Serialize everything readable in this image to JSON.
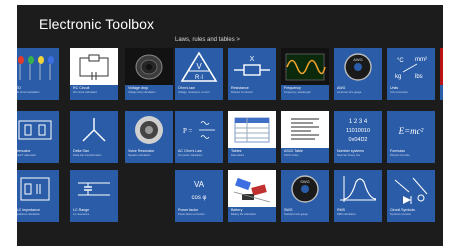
{
  "app": {
    "title": "Electronic Toolbox"
  },
  "section": {
    "heading": "Laws, rules and tables >"
  },
  "art_text": {
    "ohms_law": "V\nR·I",
    "power": "VA\ncos φ",
    "binary": "1 2 3 4\n11010010\n0x04D2",
    "emc2": "E=mc²",
    "formula": "P = ",
    "units_top": "mm²",
    "units_bottom": "lbs"
  },
  "tiles": [
    {
      "id": "led",
      "label": "LED",
      "sub": "LED circuit calculation",
      "icon": "leds-icon"
    },
    {
      "id": "rc-circuit",
      "label": "RC Circuit",
      "sub": "RC circuit calculation",
      "icon": "rc-circuit-icon"
    },
    {
      "id": "voltage-drop",
      "label": "Voltage drop",
      "sub": "Voltage drop calculation",
      "icon": "cable-spool-icon"
    },
    {
      "id": "ohms-law",
      "label": "Ohm's law",
      "sub": "Voltage, resistance, current",
      "icon": "ohms-law-icon"
    },
    {
      "id": "resistance",
      "label": "Resistance",
      "sub": "Resistor & inductor",
      "icon": "resistor-icon"
    },
    {
      "id": "frequency",
      "label": "Frequency",
      "sub": "Frequency, wavelength",
      "icon": "sine-wave-icon"
    },
    {
      "id": "awg",
      "label": "AWG",
      "sub": "American wire gauge",
      "icon": "awg-gauge-icon"
    },
    {
      "id": "units",
      "label": "Units",
      "sub": "Unit conversion",
      "icon": "units-icon"
    },
    {
      "id": "glossary",
      "label": "Glossary",
      "sub": "Glossary of terms",
      "icon": "book-icon"
    },
    {
      "id": "attenuator",
      "label": "Attenuator",
      "sub": "Pi and T attenuator",
      "icon": "attenuator-icon"
    },
    {
      "id": "delta-star",
      "label": "Delta Star",
      "sub": "Delta-star transformation",
      "icon": "delta-star-icon"
    },
    {
      "id": "voice-resonator",
      "label": "Voice Resonator",
      "sub": "Speaker calculation",
      "icon": "speaker-icon"
    },
    {
      "id": "ac-ohms-law",
      "label": "AC Ohm's Law",
      "sub": "AC power calculation",
      "icon": "ac-formula-icon"
    },
    {
      "id": "tables",
      "label": "Tables",
      "sub": "Data tables",
      "icon": "table-icon"
    },
    {
      "id": "ascii-table",
      "label": "ASCII Table",
      "sub": "ASCII codes",
      "icon": "ascii-list-icon"
    },
    {
      "id": "number-systems",
      "label": "Number systems",
      "sub": "Decimal, binary, hex",
      "icon": "binary-icon"
    },
    {
      "id": "formulas",
      "label": "Formulas",
      "sub": "Physics formulas",
      "icon": "emc2-icon"
    },
    {
      "id": "rlc-impedance",
      "label": "RLC Impedance",
      "sub": "Impedance calculation",
      "icon": "rlc-circuit-icon"
    },
    {
      "id": "lc-range",
      "label": "LC Range",
      "sub": "LC resonance",
      "icon": "lc-circuit-icon"
    },
    {
      "id": "power-factor",
      "label": "Power factor",
      "sub": "Power factor correction",
      "icon": "power-factor-icon"
    },
    {
      "id": "battery",
      "label": "Battery",
      "sub": "Battery life calculation",
      "icon": "components-icon"
    },
    {
      "id": "swg",
      "label": "SWG",
      "sub": "Standard wire gauge",
      "icon": "swg-gauge-icon"
    },
    {
      "id": "rms",
      "label": "RMS",
      "sub": "RMS calculation",
      "icon": "rms-curve-icon"
    },
    {
      "id": "circuit-symbols",
      "label": "Circuit Symbols",
      "sub": "Symbols overview",
      "icon": "circuit-symbols-icon"
    }
  ]
}
